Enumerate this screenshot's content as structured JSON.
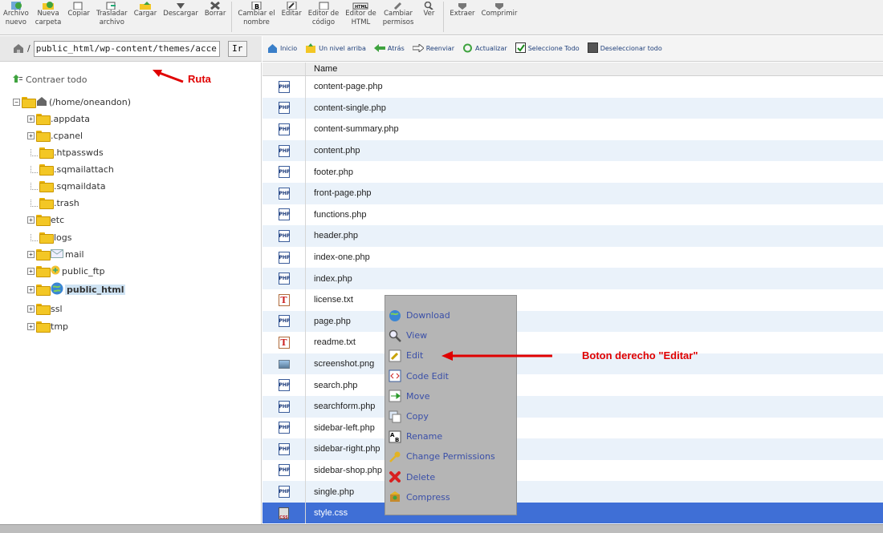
{
  "toolbar": {
    "buttons": [
      {
        "label": "Archivo\nnuevo",
        "icon": "new-file-icon"
      },
      {
        "label": "Nueva\ncarpeta",
        "icon": "new-folder-icon"
      },
      {
        "label": "Copiar",
        "icon": "copy-icon"
      },
      {
        "label": "Trasladar\narchivo",
        "icon": "move-icon"
      },
      {
        "label": "Cargar",
        "icon": "upload-icon"
      },
      {
        "label": "Descargar",
        "icon": "download-icon"
      },
      {
        "label": "Borrar",
        "icon": "delete-icon"
      },
      {
        "label": "Cambiar el\nnombre",
        "icon": "rename-icon"
      },
      {
        "label": "Editar",
        "icon": "edit-icon"
      },
      {
        "label": "Editor de\ncódigo",
        "icon": "code-editor-icon"
      },
      {
        "label": "Editor de\nHTML",
        "icon": "html-editor-icon"
      },
      {
        "label": "Cambiar\npermisos",
        "icon": "permissions-icon"
      },
      {
        "label": "Ver",
        "icon": "view-icon"
      },
      {
        "label": "Extraer",
        "icon": "extract-icon"
      },
      {
        "label": "Comprimir",
        "icon": "compress-icon"
      }
    ]
  },
  "address": {
    "path_prefix": "/",
    "path_value": "public_html/wp-content/themes/accessp",
    "go_label": "Ir"
  },
  "actions": {
    "home": "Inicio",
    "up": "Un nivel arriba",
    "back": "Atrás",
    "forward": "Reenviar",
    "refresh": "Actualizar",
    "select_all": "Seleccione Todo",
    "deselect_all": "Deseleccionar todo"
  },
  "tree": {
    "collapse_all": "Contraer todo",
    "root": "(/home/oneandon)",
    "nodes": [
      {
        "name": ".appdata",
        "expandable": true
      },
      {
        "name": ".cpanel",
        "expandable": true
      },
      {
        "name": ".htpasswds",
        "expandable": false
      },
      {
        "name": ".sqmailattach",
        "expandable": false
      },
      {
        "name": ".sqmaildata",
        "expandable": false
      },
      {
        "name": ".trash",
        "expandable": false
      },
      {
        "name": "etc",
        "expandable": true
      },
      {
        "name": "logs",
        "expandable": false
      },
      {
        "name": "mail",
        "expandable": true
      },
      {
        "name": "public_ftp",
        "expandable": true
      },
      {
        "name": "public_html",
        "expandable": true,
        "selected": true
      },
      {
        "name": "ssl",
        "expandable": true
      },
      {
        "name": "tmp",
        "expandable": true
      }
    ]
  },
  "annotations": {
    "path_label": "Ruta",
    "edit_label": "Boton derecho \"Editar\""
  },
  "table": {
    "header": "Name",
    "files": [
      {
        "name": "content-page.php",
        "type": "php"
      },
      {
        "name": "content-single.php",
        "type": "php"
      },
      {
        "name": "content-summary.php",
        "type": "php"
      },
      {
        "name": "content.php",
        "type": "php"
      },
      {
        "name": "footer.php",
        "type": "php"
      },
      {
        "name": "front-page.php",
        "type": "php"
      },
      {
        "name": "functions.php",
        "type": "php"
      },
      {
        "name": "header.php",
        "type": "php"
      },
      {
        "name": "index-one.php",
        "type": "php"
      },
      {
        "name": "index.php",
        "type": "php"
      },
      {
        "name": "license.txt",
        "type": "txt"
      },
      {
        "name": "page.php",
        "type": "php"
      },
      {
        "name": "readme.txt",
        "type": "txt"
      },
      {
        "name": "screenshot.png",
        "type": "png"
      },
      {
        "name": "search.php",
        "type": "php"
      },
      {
        "name": "searchform.php",
        "type": "php"
      },
      {
        "name": "sidebar-left.php",
        "type": "php"
      },
      {
        "name": "sidebar-right.php",
        "type": "php"
      },
      {
        "name": "sidebar-shop.php",
        "type": "php"
      },
      {
        "name": "single.php",
        "type": "php"
      },
      {
        "name": "style.css",
        "type": "css",
        "selected": true
      }
    ]
  },
  "context_menu": {
    "items": [
      {
        "label": "Download",
        "icon": "globe-download-icon"
      },
      {
        "label": "View",
        "icon": "magnifier-icon"
      },
      {
        "label": "Edit",
        "icon": "pencil-icon"
      },
      {
        "label": "Code Edit",
        "icon": "code-icon"
      },
      {
        "label": "Move",
        "icon": "move-arrow-icon"
      },
      {
        "label": "Copy",
        "icon": "copy-pages-icon"
      },
      {
        "label": "Rename",
        "icon": "rename-ab-icon"
      },
      {
        "label": "Change Permissions",
        "icon": "key-icon"
      },
      {
        "label": "Delete",
        "icon": "red-x-icon"
      },
      {
        "label": "Compress",
        "icon": "compress-box-icon"
      }
    ]
  }
}
